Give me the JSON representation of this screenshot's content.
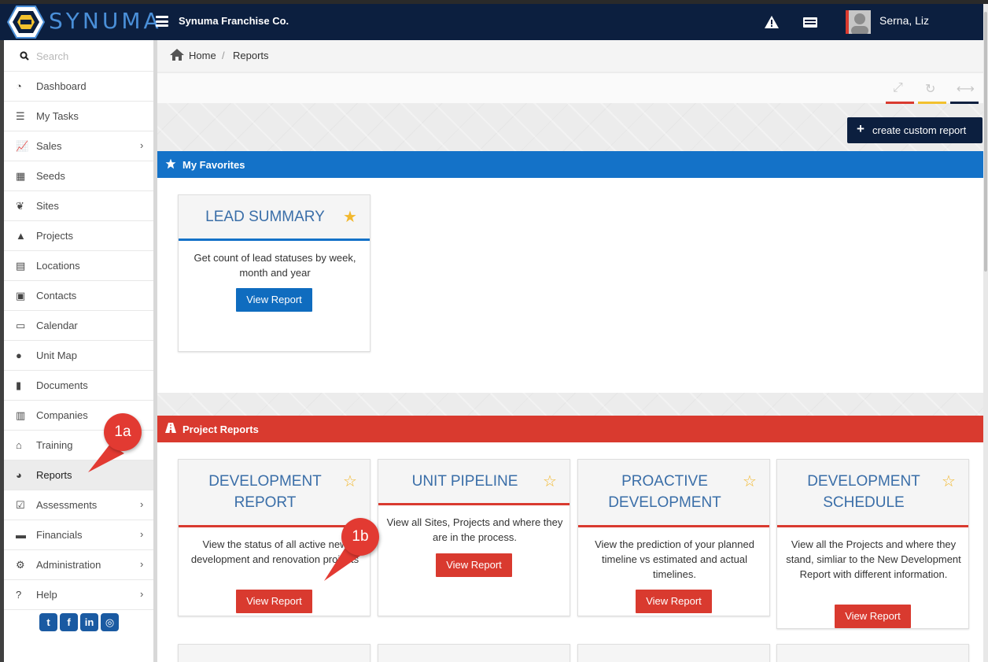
{
  "header": {
    "logo_text": "SYNUMA",
    "company": "Synuma Franchise Co.",
    "user": "Serna, Liz"
  },
  "sidebar": {
    "search_placeholder": "Search",
    "items": [
      {
        "label": "Dashboard",
        "icon": "dashboard-icon",
        "chevron": false
      },
      {
        "label": "My Tasks",
        "icon": "tasks-icon",
        "chevron": false
      },
      {
        "label": "Sales",
        "icon": "chart-icon",
        "chevron": true
      },
      {
        "label": "Seeds",
        "icon": "grid-icon",
        "chevron": false
      },
      {
        "label": "Sites",
        "icon": "leaf-icon",
        "chevron": false
      },
      {
        "label": "Projects",
        "icon": "road-icon",
        "chevron": false
      },
      {
        "label": "Locations",
        "icon": "building-icon",
        "chevron": false
      },
      {
        "label": "Contacts",
        "icon": "contact-icon",
        "chevron": false
      },
      {
        "label": "Calendar",
        "icon": "calendar-icon",
        "chevron": false
      },
      {
        "label": "Unit Map",
        "icon": "globe-icon",
        "chevron": false
      },
      {
        "label": "Documents",
        "icon": "document-icon",
        "chevron": false
      },
      {
        "label": "Companies",
        "icon": "company-icon",
        "chevron": false
      },
      {
        "label": "Training",
        "icon": "graduation-icon",
        "chevron": false
      },
      {
        "label": "Reports",
        "icon": "pie-chart-icon",
        "chevron": false,
        "active": true
      },
      {
        "label": "Assessments",
        "icon": "checkbox-icon",
        "chevron": true
      },
      {
        "label": "Financials",
        "icon": "money-icon",
        "chevron": true
      },
      {
        "label": "Administration",
        "icon": "cogs-icon",
        "chevron": true
      },
      {
        "label": "Help",
        "icon": "question-icon",
        "chevron": true
      }
    ],
    "social": [
      "twitter-icon",
      "facebook-icon",
      "linkedin-icon",
      "instagram-icon"
    ]
  },
  "breadcrumb": {
    "home": "Home",
    "separator": "/",
    "current": "Reports"
  },
  "actions": {
    "create_label": "create custom report"
  },
  "favorites": {
    "title": "My Favorites",
    "cards": [
      {
        "title": "LEAD SUMMARY",
        "desc": "Get count of lead statuses by week, month and year",
        "button": "View Report",
        "starred": true
      }
    ]
  },
  "project_reports": {
    "title": "Project Reports",
    "cards": [
      {
        "title": "DEVELOPMENT REPORT",
        "desc": "View the status of all active new development and renovation projects",
        "button": "View Report",
        "starred": false
      },
      {
        "title": "UNIT PIPELINE",
        "desc": "View all Sites, Projects and where they are in the process.",
        "button": "View Report",
        "starred": false
      },
      {
        "title": "PROACTIVE DEVELOPMENT",
        "desc": "View the prediction of your planned timeline vs estimated and actual timelines.",
        "button": "View Report",
        "starred": false
      },
      {
        "title": "DEVELOPMENT SCHEDULE",
        "desc": "View all the Projects and where they stand, simliar to the New Development Report with different information.",
        "button": "View Report",
        "starred": false
      }
    ]
  },
  "callouts": {
    "a": "1a",
    "b": "1b"
  },
  "colors": {
    "navy": "#0c1f3f",
    "blue": "#1472c8",
    "red": "#d93a2f",
    "yellow": "#f2c12e"
  }
}
